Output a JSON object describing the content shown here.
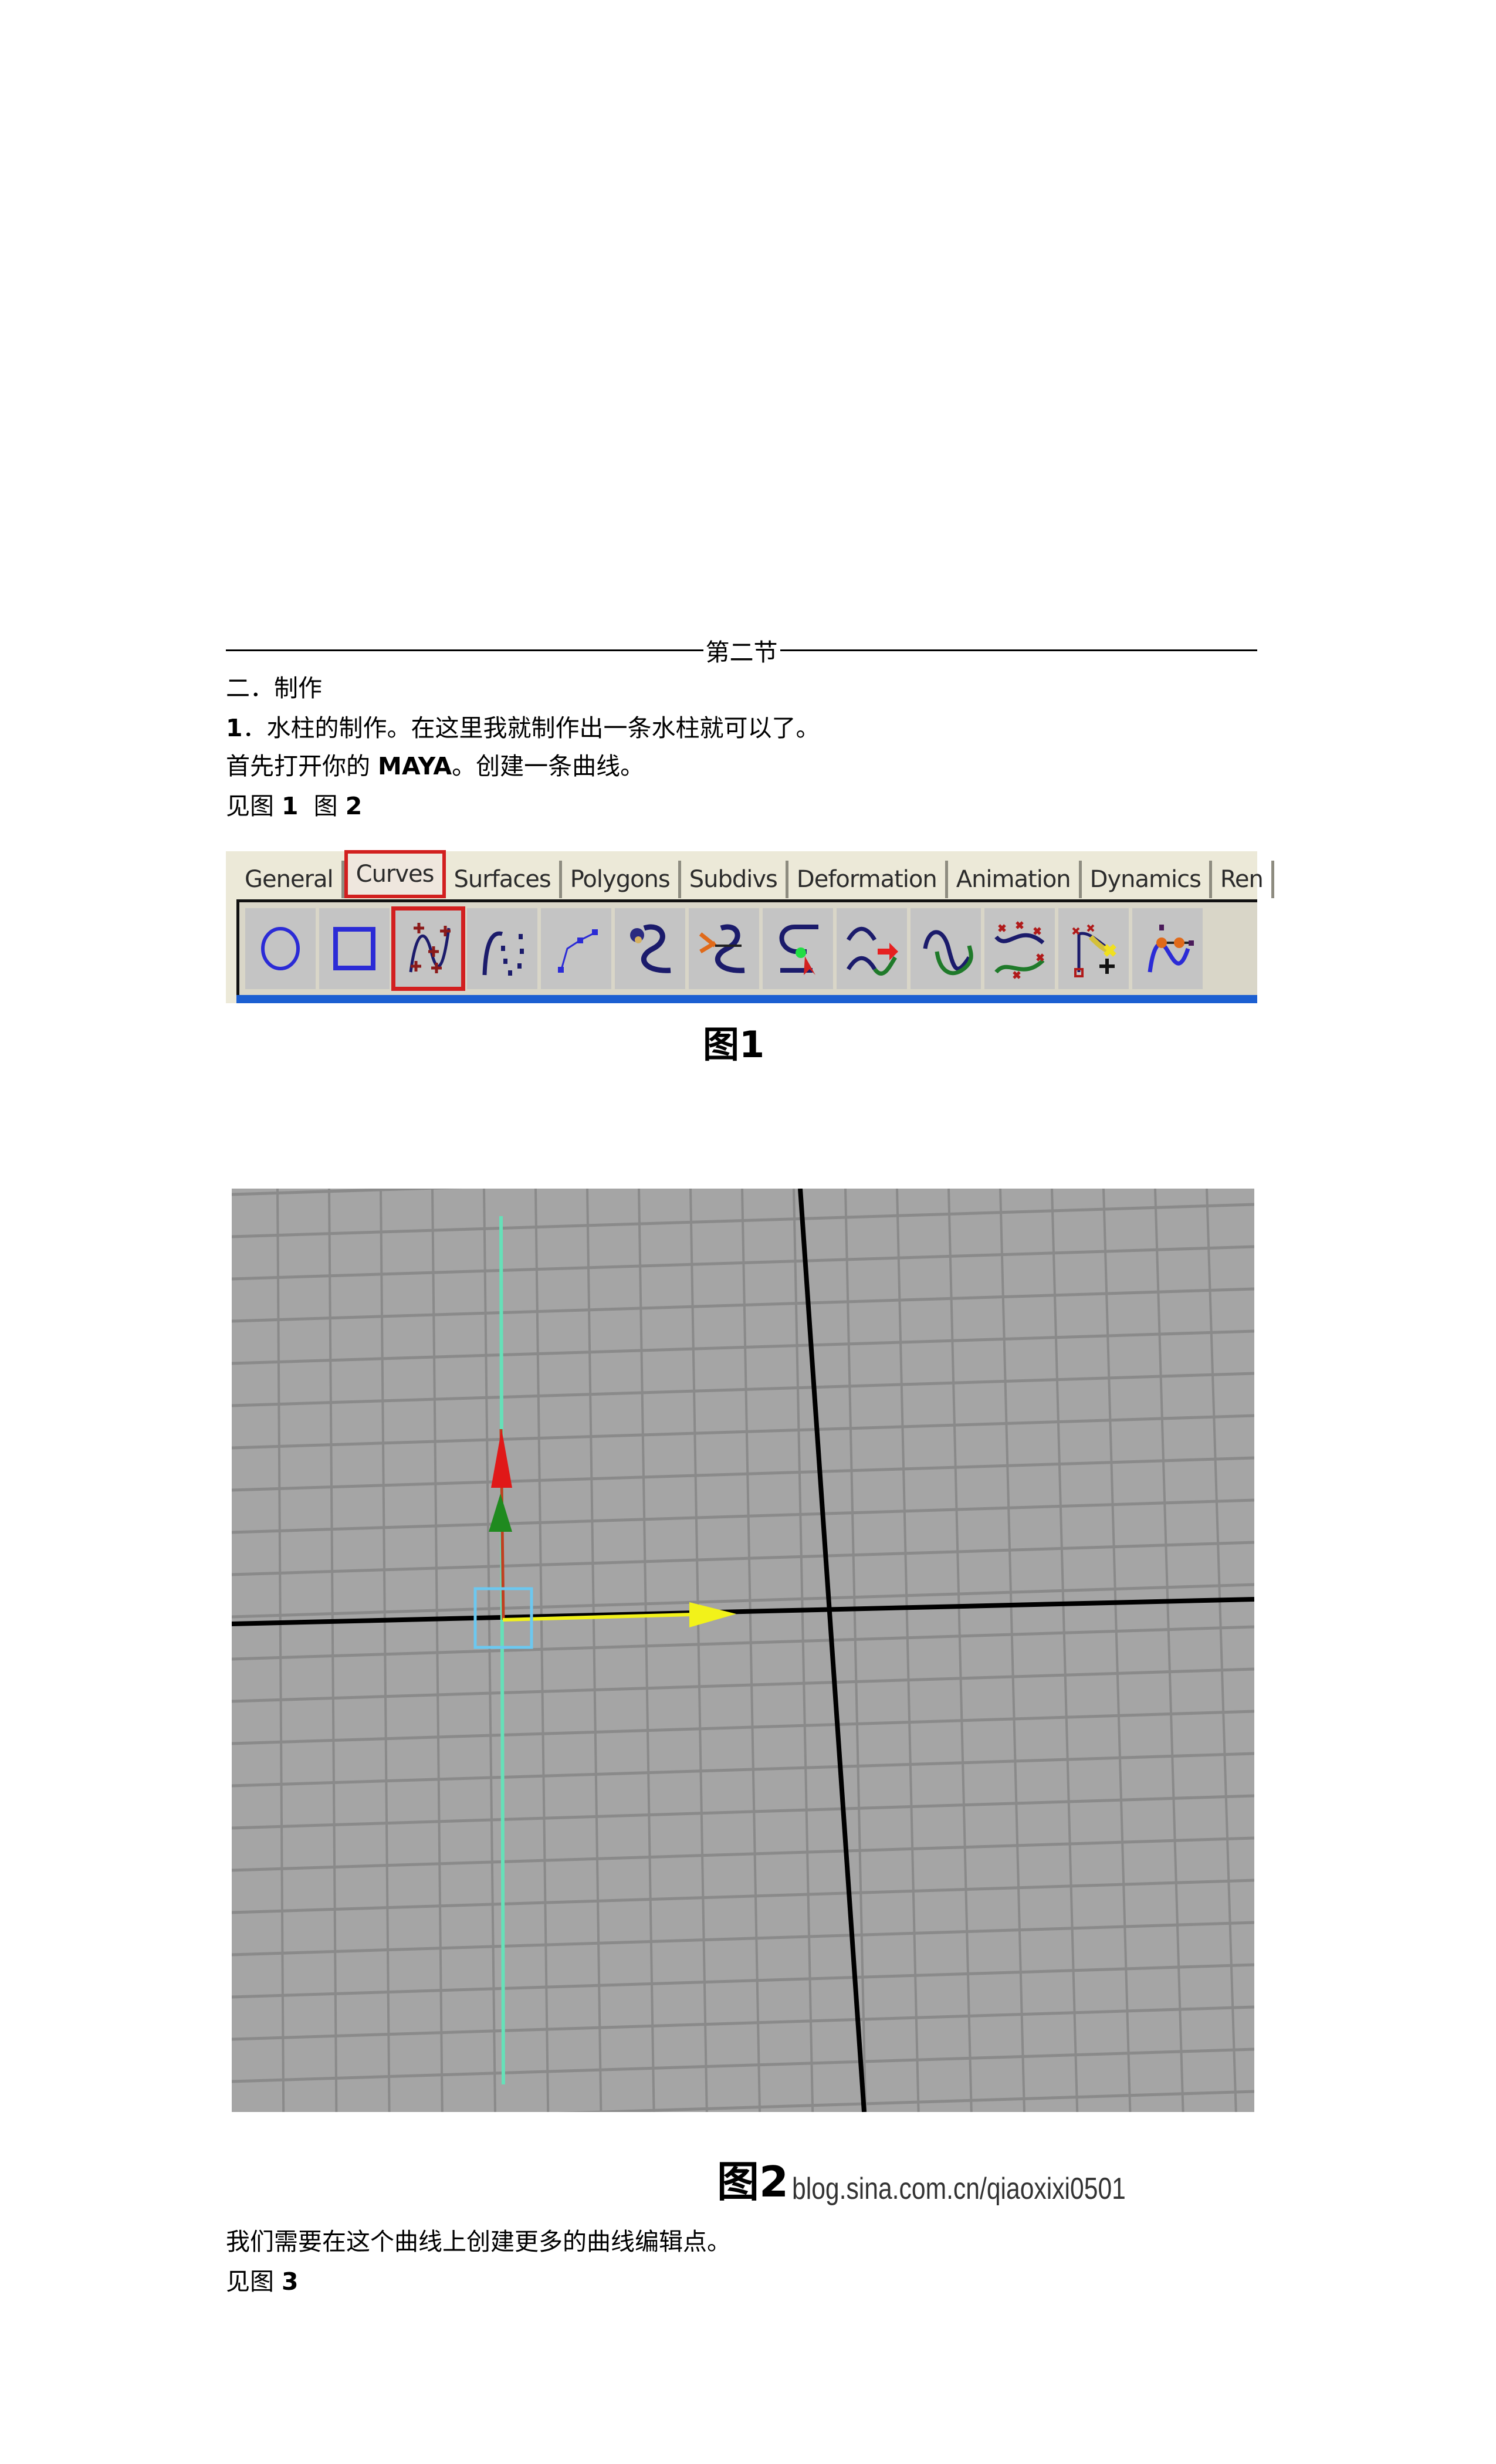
{
  "section_divider": {
    "label": "第二节"
  },
  "heading": "二．制作",
  "step1": {
    "number": "1",
    "text": "．水柱的制作。在这里我就制作出一条水柱就可以了。"
  },
  "intro": {
    "before": "首先打开你的 ",
    "maya": "MAYA",
    "after": "。创建一条曲线。"
  },
  "see_figs": {
    "prefix": "见图 ",
    "fig1": "1",
    "mid": "  图 ",
    "fig2": "2"
  },
  "figure1": {
    "caption": "图1",
    "tabs": [
      {
        "label": "General",
        "active": false
      },
      {
        "label": "Curves",
        "active": true
      },
      {
        "label": "Surfaces",
        "active": false
      },
      {
        "label": "Polygons",
        "active": false
      },
      {
        "label": "Subdivs",
        "active": false
      },
      {
        "label": "Deformation",
        "active": false
      },
      {
        "label": "Animation",
        "active": false
      },
      {
        "label": "Dynamics",
        "active": false
      },
      {
        "label": "Ren",
        "active": false
      }
    ],
    "shelf_icons": [
      "nurbs-circle-icon",
      "nurbs-square-icon",
      "cv-curve-tool-icon",
      "ep-curve-tool-icon",
      "pencil-curve-tool-icon",
      "attach-curves-icon",
      "detach-curves-icon",
      "insert-knot-icon",
      "extend-curve-icon",
      "offset-curve-icon",
      "rebuild-curve-icon",
      "add-points-tool-icon",
      "curve-editing-tool-icon"
    ],
    "selected_icon": "cv-curve-tool-icon",
    "highlight_color": "#d21f1f"
  },
  "figure2": {
    "caption": "图2",
    "watermark": "blog.sina.com.cn/qiaoxixi0501",
    "colors": {
      "background": "#a5a5a5",
      "grid": "#8a8a8a",
      "axis": "#000000",
      "curve": "#66e0b8",
      "manipulator_box": "#6cc8f0",
      "x_arrow": "#f2f21a",
      "y_arrow": "#e01818",
      "z_arrow": "#1f8a1f"
    }
  },
  "followup": "我们需要在这个曲线上创建更多的曲线编辑点。",
  "see_fig3": {
    "prefix": "见图 ",
    "fig": "3"
  }
}
